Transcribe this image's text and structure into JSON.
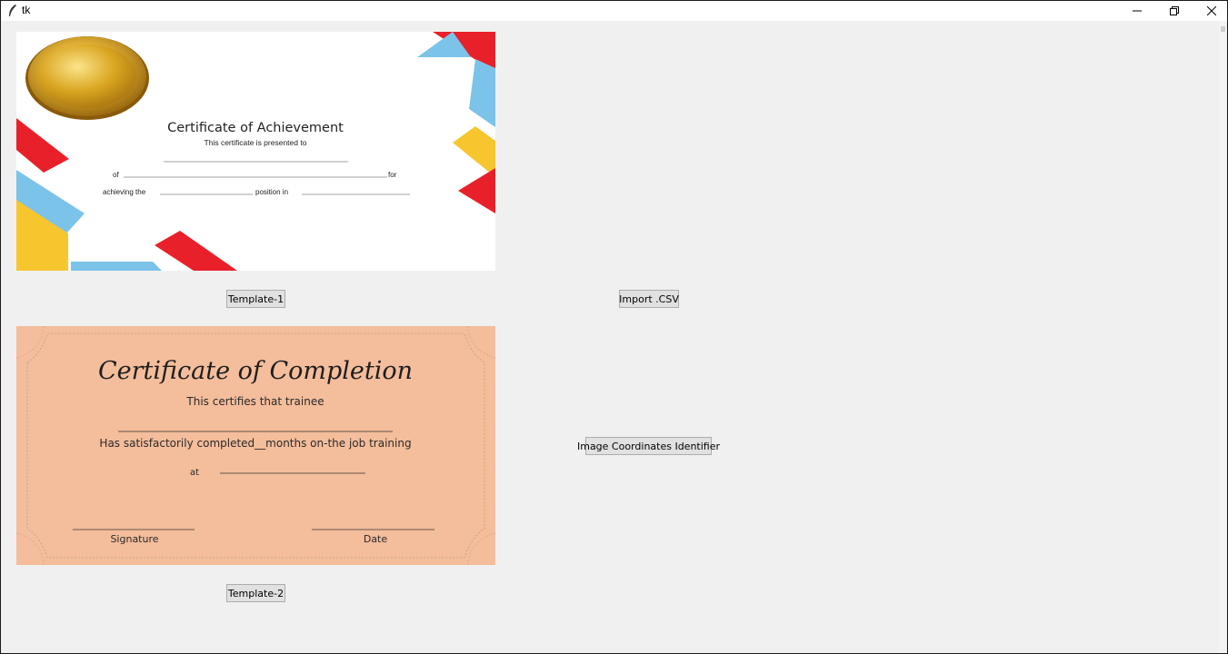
{
  "window": {
    "title": "tk",
    "controls": {
      "minimize": "minimize-icon",
      "restore": "restore-icon",
      "close": "close-icon"
    }
  },
  "templates": [
    {
      "title": "Certificate of Achievement",
      "subtitle": "This certificate is presented to",
      "of_label": "of",
      "for_label": "for",
      "achieving_label": "achieving the",
      "position_label": "position in",
      "button_label": "Template-1",
      "colors": {
        "red": "#e8202a",
        "blue": "#7bc3e8",
        "yellow": "#f7c62f",
        "gold": "#d9a520"
      }
    },
    {
      "title": "Certificate of Completion",
      "subtitle": "This certifies that trainee",
      "body_text": "Has satisfactorily completed__months on-the job training",
      "at_label": "at",
      "signature_label": "Signature",
      "date_label": "Date",
      "button_label": "Template-2",
      "colors": {
        "background": "#f4bd9b",
        "text": "#2a2a2a"
      }
    }
  ],
  "actions": {
    "import_csv": "Import .CSV",
    "coordinates": "Image Coordinates Identifier"
  }
}
